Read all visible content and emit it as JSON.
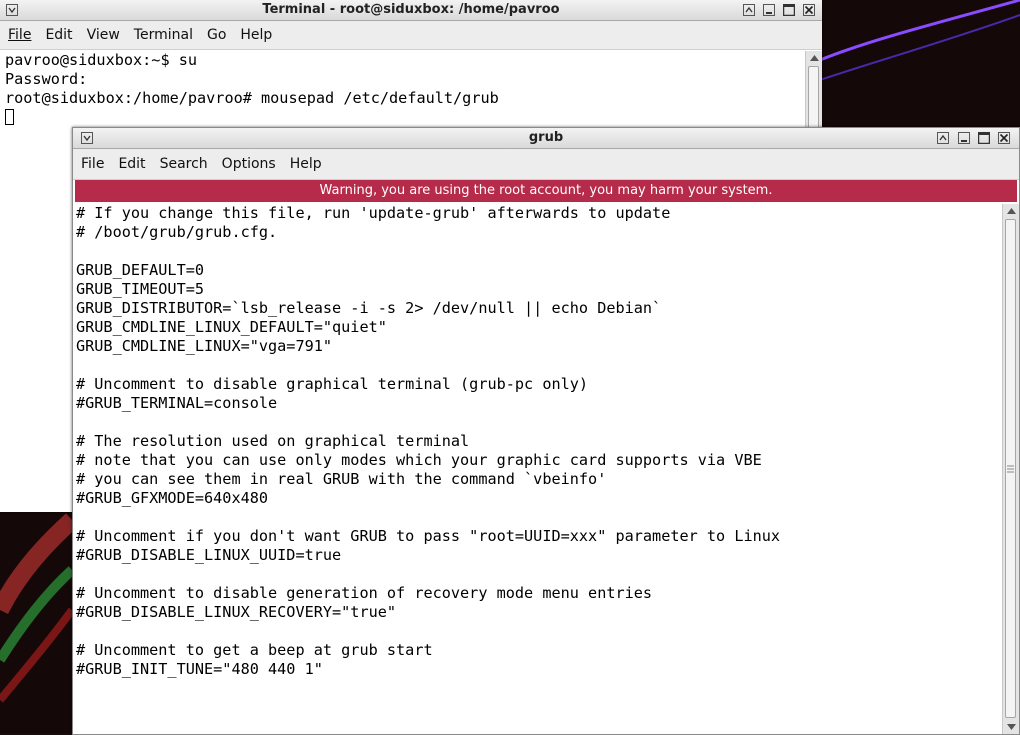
{
  "terminal": {
    "title": "Terminal - root@siduxbox: /home/pavroo",
    "menu": [
      "File",
      "Edit",
      "View",
      "Terminal",
      "Go",
      "Help"
    ],
    "lines": [
      "pavroo@siduxbox:~$ su",
      "Password:",
      "root@siduxbox:/home/pavroo# mousepad /etc/default/grub"
    ]
  },
  "editor": {
    "title": "grub",
    "menu": [
      "File",
      "Edit",
      "Search",
      "Options",
      "Help"
    ],
    "warning": "Warning, you are using the root account, you may harm your system.",
    "lines": [
      "# If you change this file, run 'update-grub' afterwards to update",
      "# /boot/grub/grub.cfg.",
      "",
      "GRUB_DEFAULT=0",
      "GRUB_TIMEOUT=5",
      "GRUB_DISTRIBUTOR=`lsb_release -i -s 2> /dev/null || echo Debian`",
      "GRUB_CMDLINE_LINUX_DEFAULT=\"quiet\"",
      "GRUB_CMDLINE_LINUX=\"vga=791\"",
      "",
      "# Uncomment to disable graphical terminal (grub-pc only)",
      "#GRUB_TERMINAL=console",
      "",
      "# The resolution used on graphical terminal",
      "# note that you can use only modes which your graphic card supports via VBE",
      "# you can see them in real GRUB with the command `vbeinfo'",
      "#GRUB_GFXMODE=640x480",
      "",
      "# Uncomment if you don't want GRUB to pass \"root=UUID=xxx\" parameter to Linux",
      "#GRUB_DISABLE_LINUX_UUID=true",
      "",
      "# Uncomment to disable generation of recovery mode menu entries",
      "#GRUB_DISABLE_LINUX_RECOVERY=\"true\"",
      "",
      "# Uncomment to get a beep at grub start",
      "#GRUB_INIT_TUNE=\"480 440 1\""
    ]
  },
  "icons": {
    "window_menu": "window-menu-icon",
    "shade": "shade-icon",
    "minimize": "minimize-icon",
    "maximize": "maximize-icon",
    "close": "close-icon"
  },
  "colors": {
    "warning_bg": "#b62a4a",
    "desktop_accent": "#7a3cff"
  }
}
